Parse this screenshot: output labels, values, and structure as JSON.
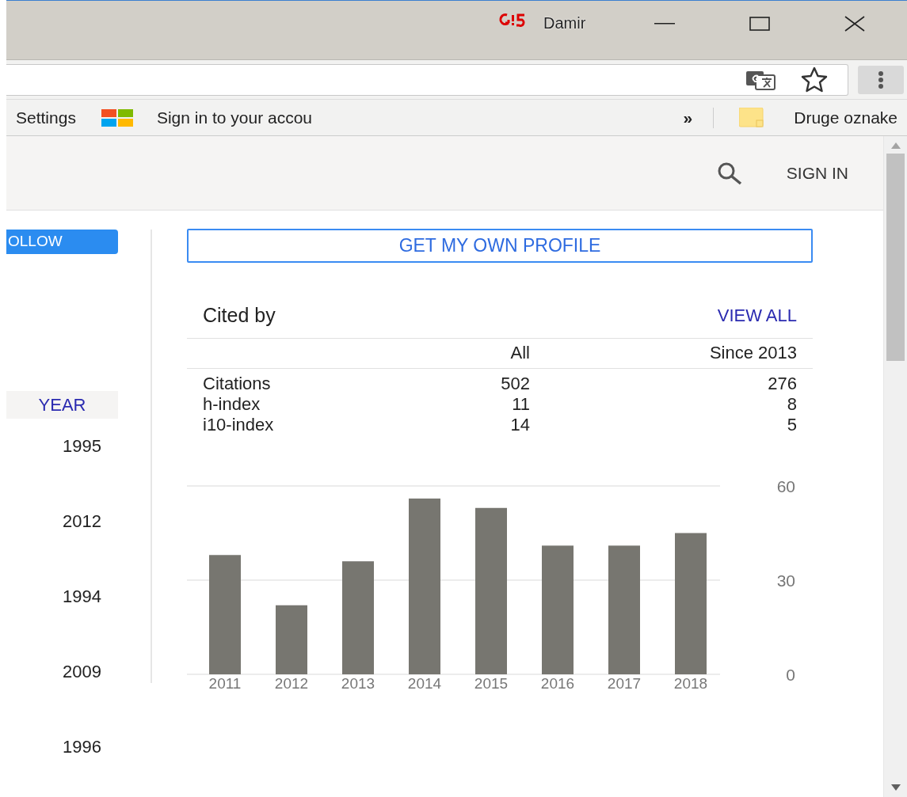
{
  "window": {
    "user": "Damir"
  },
  "bookmarks": [
    {
      "label": "Settings",
      "kind": "plain"
    },
    {
      "label": "Sign in to your accou",
      "kind": "app"
    }
  ],
  "bookmarks_overflow": "»",
  "other_bookmarks": "Druge oznake",
  "header": {
    "sign_in": "SIGN IN"
  },
  "follow_button": "OLLOW",
  "sort_label": "YEAR",
  "years": [
    "1995",
    "2012",
    "1994",
    "2009",
    "1996"
  ],
  "profile_button": "GET MY OWN PROFILE",
  "cited_by": {
    "title": "Cited by",
    "view_all": "VIEW ALL",
    "columns": [
      "All",
      "Since 2013"
    ],
    "rows": [
      {
        "label": "Citations",
        "all": "502",
        "since": "276"
      },
      {
        "label": "h-index",
        "all": "11",
        "since": "8"
      },
      {
        "label": "i10-index",
        "all": "14",
        "since": "5"
      }
    ],
    "chart_data": {
      "type": "bar",
      "categories": [
        "2011",
        "2012",
        "2013",
        "2014",
        "2015",
        "2016",
        "2017",
        "2018"
      ],
      "series": [
        {
          "color": "#777670",
          "values": [
            38,
            22,
            36,
            56,
            53,
            41,
            41,
            45
          ]
        }
      ],
      "ylim": [
        0,
        60
      ],
      "yticks": [
        0,
        30,
        60
      ]
    }
  }
}
